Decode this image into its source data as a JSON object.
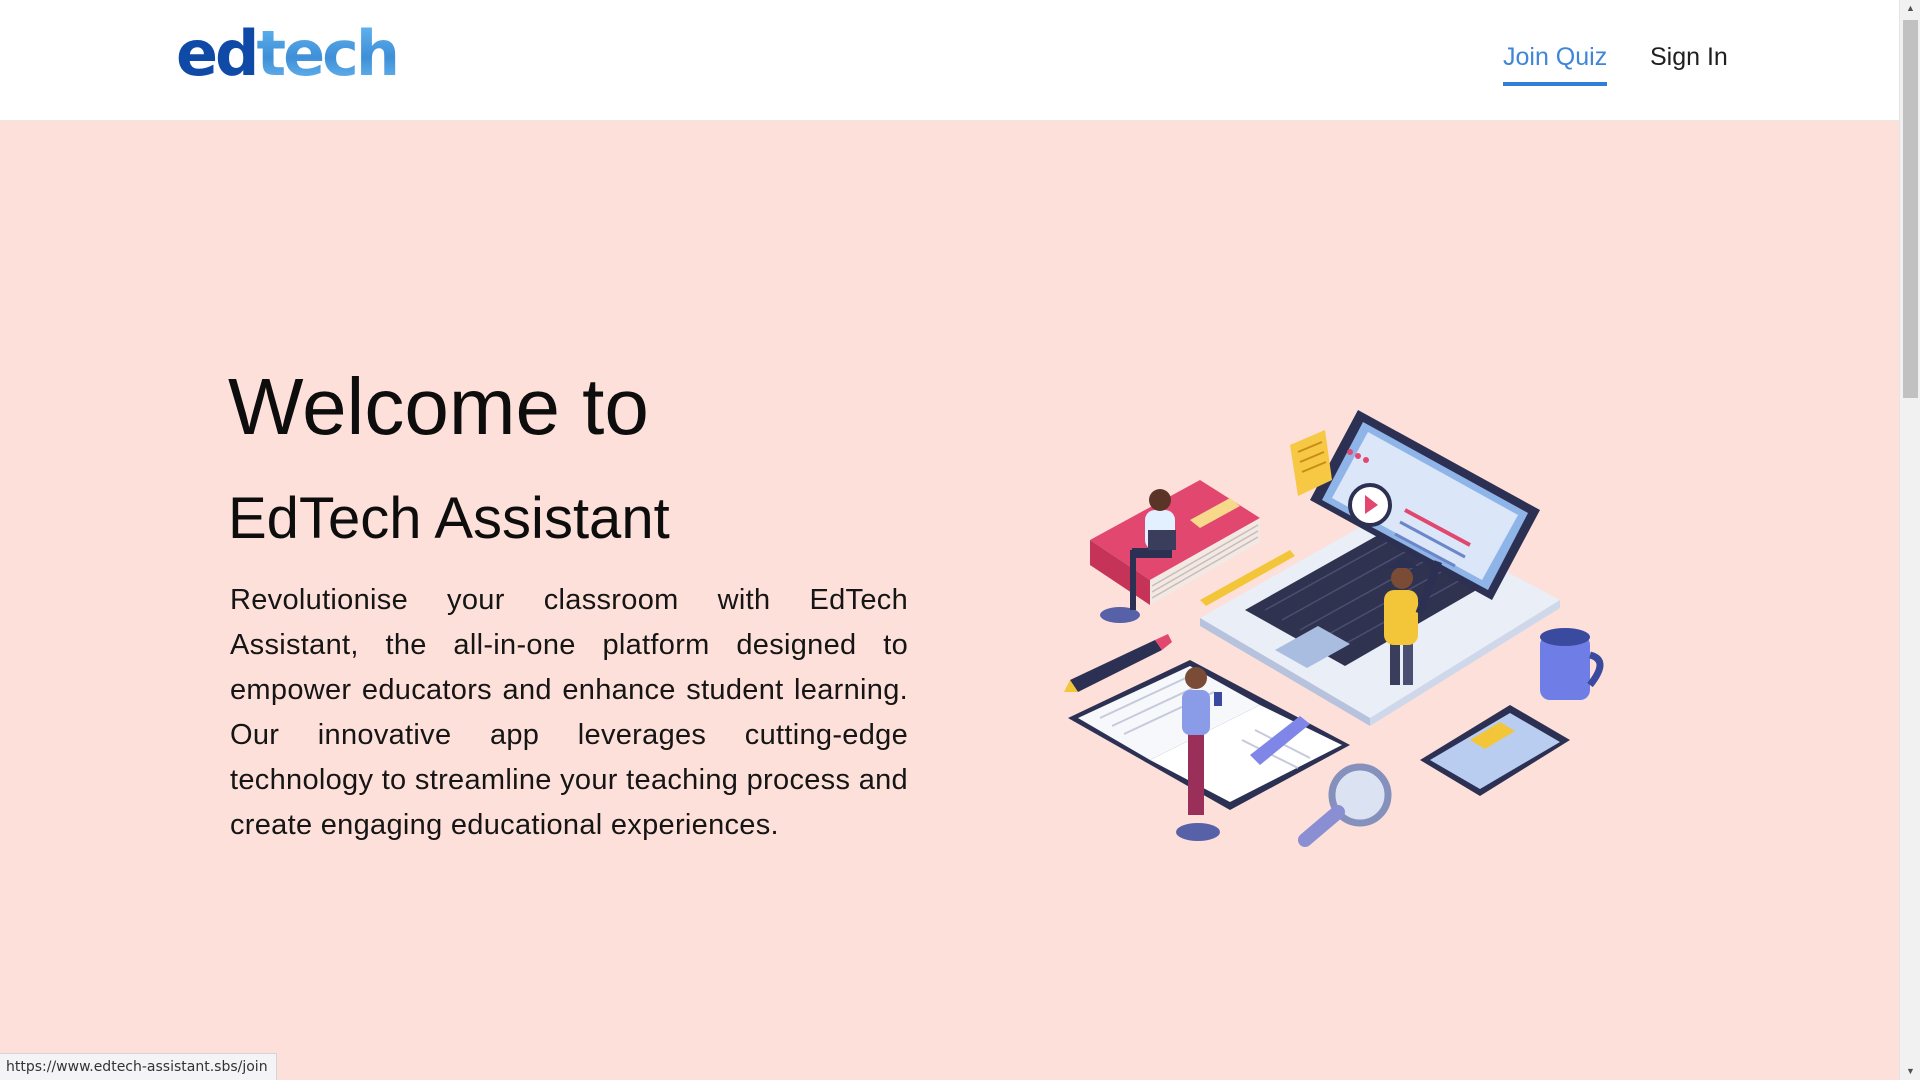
{
  "header": {
    "logo": {
      "part1": "ed",
      "part2": "tech"
    },
    "nav": [
      {
        "label": "Join Quiz",
        "active": true
      },
      {
        "label": "Sign In",
        "active": false
      }
    ]
  },
  "hero": {
    "title": "Welcome to",
    "subtitle": "EdTech Assistant",
    "description": "Revolutionise your classroom with EdTech Assistant, the all-in-one platform designed to empower educators and enhance student learning. Our innovative app leverages cutting-edge technology to streamline your teaching process and create engaging educational experiences."
  },
  "status_bar": {
    "url": "https://www.edtech-assistant.sbs/join"
  },
  "colors": {
    "page_background": "#fde0d9",
    "header_background": "#ffffff",
    "accent": "#3f86d8",
    "logo_dark": "#0f4aa6",
    "logo_light": "#4fa3e3"
  },
  "icons": {
    "illustration": "education-isometric-illustration",
    "scroll_up": "scroll-up-arrow-icon",
    "scroll_down": "scroll-down-arrow-icon"
  }
}
